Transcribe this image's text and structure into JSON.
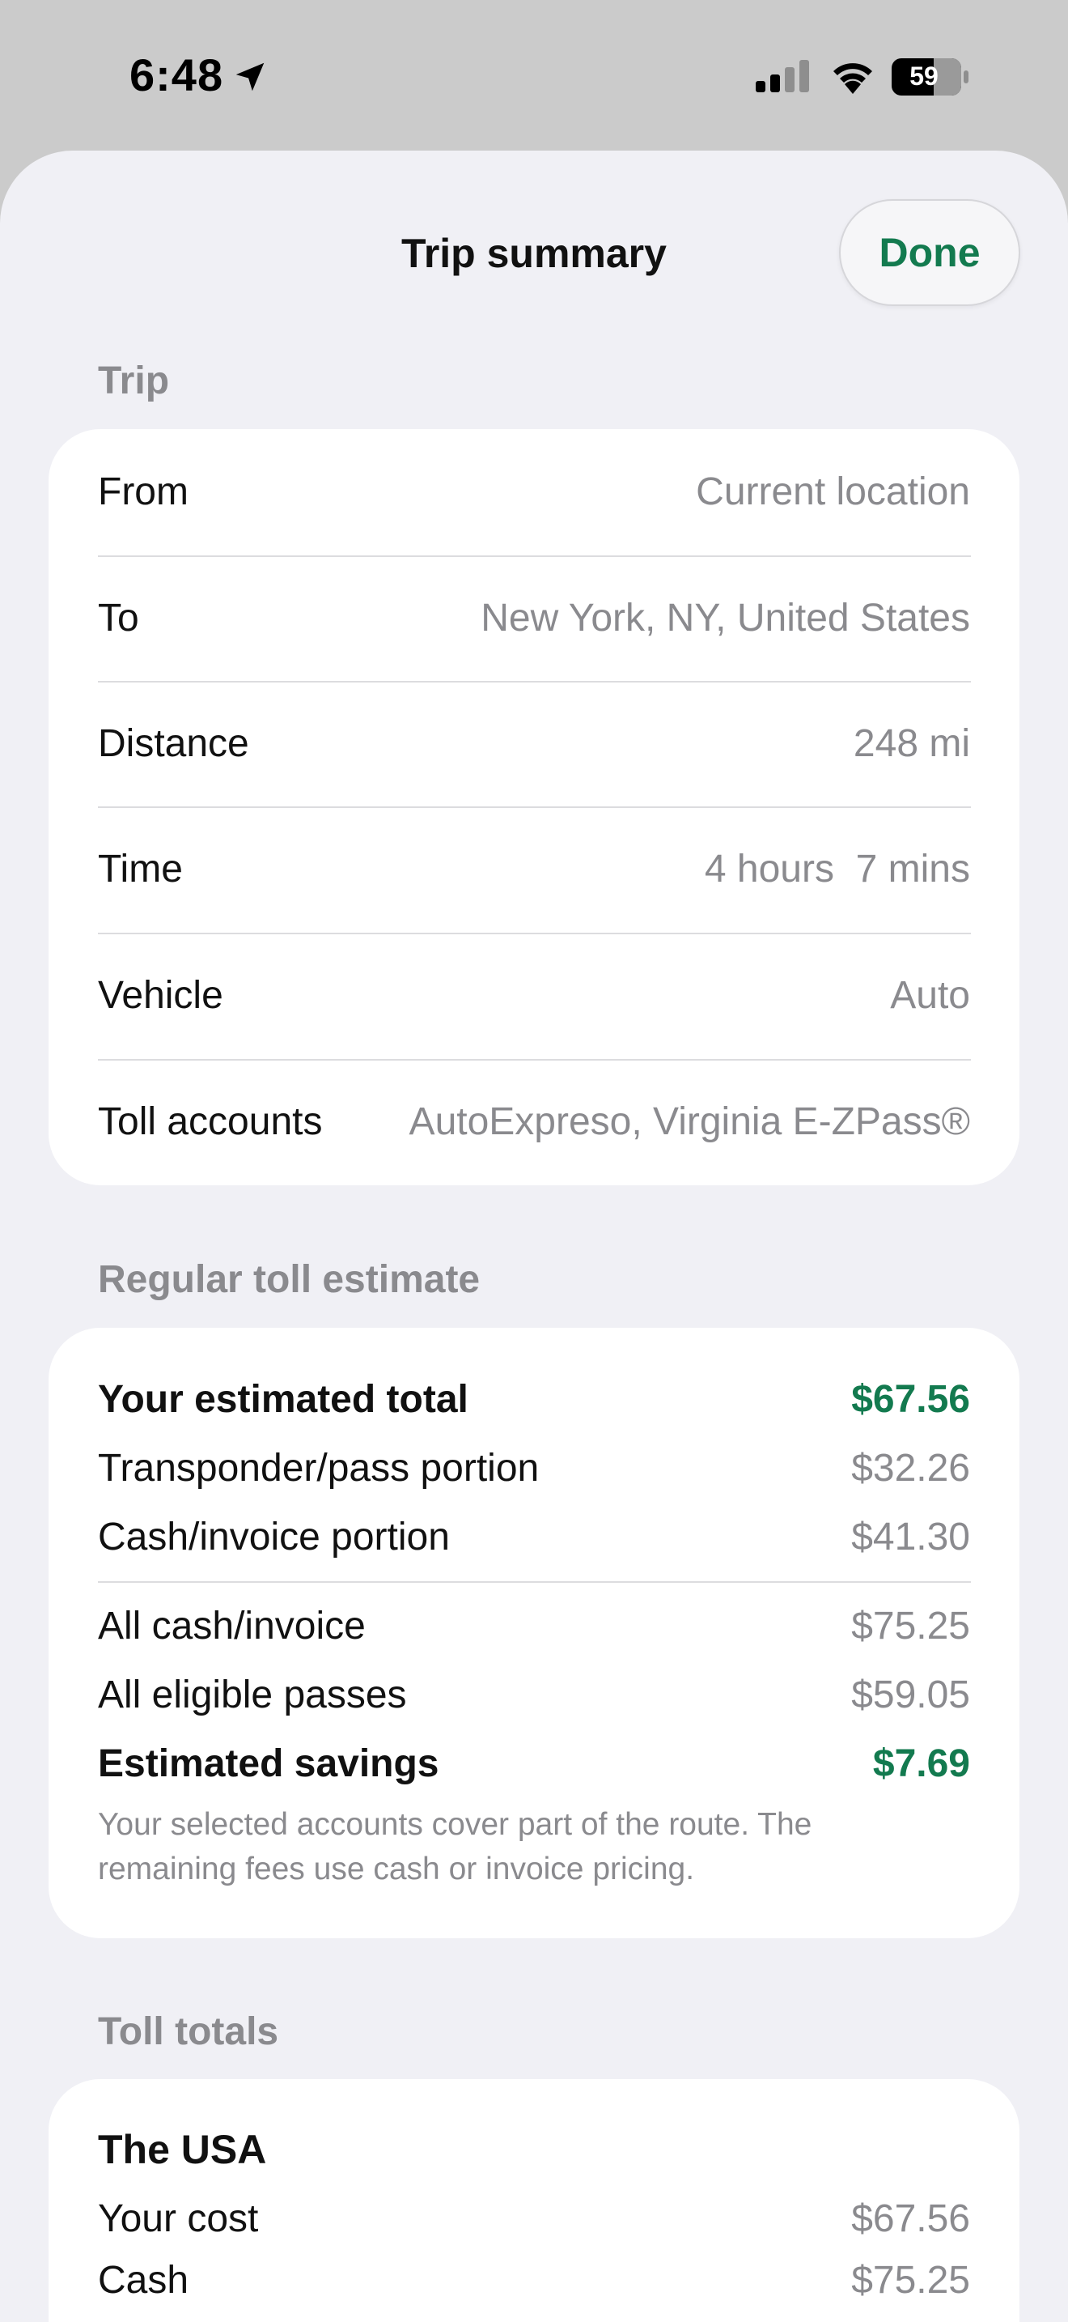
{
  "status": {
    "time": "6:48",
    "battery": "59"
  },
  "nav": {
    "title": "Trip summary",
    "done_label": "Done"
  },
  "trip": {
    "header": "Trip",
    "rows": [
      {
        "label": "From",
        "value": "Current location"
      },
      {
        "label": "To",
        "value": "New York, NY, United States"
      },
      {
        "label": "Distance",
        "value": "248 mi"
      },
      {
        "label": "Time",
        "value": "4 hours  7 mins"
      },
      {
        "label": "Vehicle",
        "value": "Auto"
      },
      {
        "label": "Toll accounts",
        "value": "AutoExpreso, Virginia E-ZPass®"
      }
    ]
  },
  "estimate": {
    "header": "Regular toll estimate",
    "total_label": "Your estimated total",
    "total_value": "$67.56",
    "transponder_label": "Transponder/pass portion",
    "transponder_value": "$32.26",
    "cash_label": "Cash/invoice portion",
    "cash_value": "$41.30",
    "all_cash_label": "All cash/invoice",
    "all_cash_value": "$75.25",
    "all_passes_label": "All eligible passes",
    "all_passes_value": "$59.05",
    "savings_label": "Estimated savings",
    "savings_value": "$7.69",
    "note_line1": "Your selected accounts cover part of the route. The",
    "note_line2": "remaining fees use cash or invoice pricing."
  },
  "totals": {
    "header": "Toll totals",
    "region": "The USA",
    "your_cost_label": "Your cost",
    "your_cost_value": "$67.56",
    "cash_label": "Cash",
    "cash_value": "$75.25"
  },
  "colors": {
    "accent": "#137a4f",
    "secondary_text": "#8a8a8e",
    "sheet_bg": "#f0f0f5"
  }
}
